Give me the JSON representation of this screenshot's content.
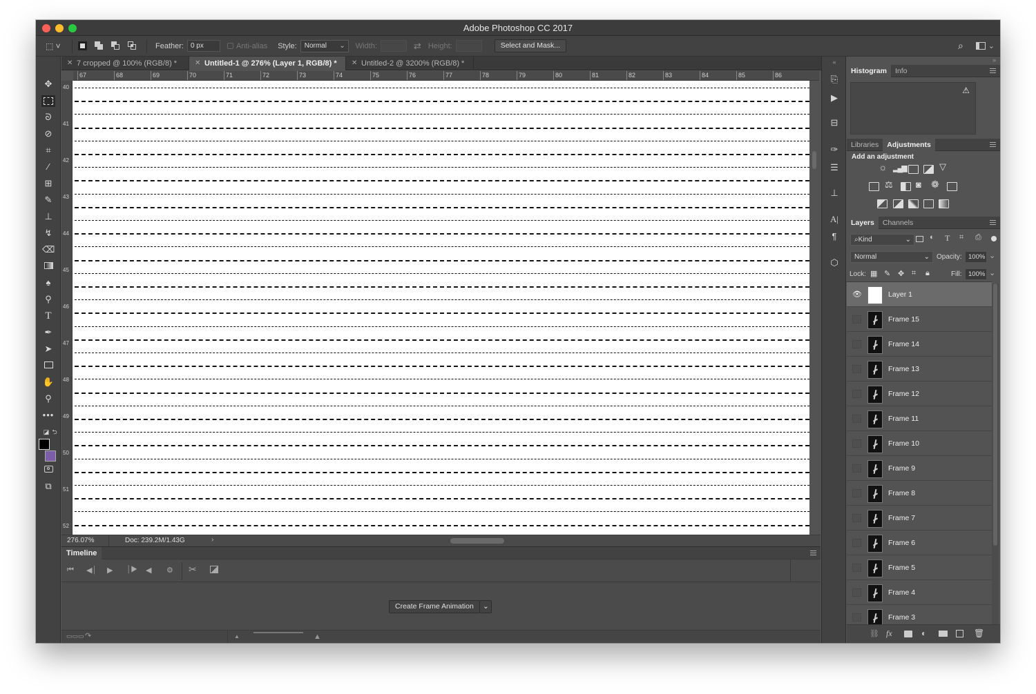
{
  "window": {
    "title": "Adobe Photoshop CC 2017"
  },
  "options_bar": {
    "feather_label": "Feather:",
    "feather_value": "0 px",
    "antialias_label": "Anti-alias",
    "style_label": "Style:",
    "style_value": "Normal",
    "width_label": "Width:",
    "height_label": "Height:",
    "select_mask_label": "Select and Mask..."
  },
  "doc_tabs": [
    {
      "label": "7 cropped @ 100% (RGB/8) *",
      "active": false
    },
    {
      "label": "Untitled-1 @ 276% (Layer 1, RGB/8) *",
      "active": true
    },
    {
      "label": "Untitled-2 @ 3200% (RGB/8) *",
      "active": false
    }
  ],
  "ruler": {
    "horizontal": [
      "67",
      "68",
      "69",
      "70",
      "71",
      "72",
      "73",
      "74",
      "75",
      "76",
      "77",
      "78",
      "79",
      "80",
      "81",
      "82",
      "83",
      "84",
      "85",
      "86"
    ],
    "vertical": [
      "40",
      "41",
      "42",
      "43",
      "44",
      "45",
      "46",
      "47",
      "48",
      "49",
      "50",
      "51",
      "52"
    ]
  },
  "status": {
    "zoom": "276.07%",
    "doc": "Doc: 239.2M/1.43G"
  },
  "timeline": {
    "title": "Timeline",
    "create_label": "Create Frame Animation"
  },
  "histogram_panel": {
    "tabs": [
      "Histogram",
      "Info"
    ]
  },
  "adjustments_panel": {
    "tabs": [
      "Libraries",
      "Adjustments"
    ],
    "add_label": "Add an adjustment"
  },
  "layers_panel": {
    "tabs": [
      "Layers",
      "Channels"
    ],
    "kind_label": "Kind",
    "blend_mode": "Normal",
    "opacity_label": "Opacity:",
    "opacity_value": "100%",
    "lock_label": "Lock:",
    "fill_label": "Fill:",
    "fill_value": "100%",
    "layers": [
      {
        "name": "Layer 1",
        "visible": true,
        "selected": true
      },
      {
        "name": "Frame 15",
        "visible": false,
        "selected": false
      },
      {
        "name": "Frame 14",
        "visible": false,
        "selected": false
      },
      {
        "name": "Frame 13",
        "visible": false,
        "selected": false
      },
      {
        "name": "Frame 12",
        "visible": false,
        "selected": false
      },
      {
        "name": "Frame 11",
        "visible": false,
        "selected": false
      },
      {
        "name": "Frame 10",
        "visible": false,
        "selected": false
      },
      {
        "name": "Frame 9",
        "visible": false,
        "selected": false
      },
      {
        "name": "Frame 8",
        "visible": false,
        "selected": false
      },
      {
        "name": "Frame 7",
        "visible": false,
        "selected": false
      },
      {
        "name": "Frame 6",
        "visible": false,
        "selected": false
      },
      {
        "name": "Frame 5",
        "visible": false,
        "selected": false
      },
      {
        "name": "Frame 4",
        "visible": false,
        "selected": false
      },
      {
        "name": "Frame 3",
        "visible": false,
        "selected": false
      }
    ]
  },
  "colors": {
    "foreground": "#000000",
    "background": "#7b5ea7"
  }
}
